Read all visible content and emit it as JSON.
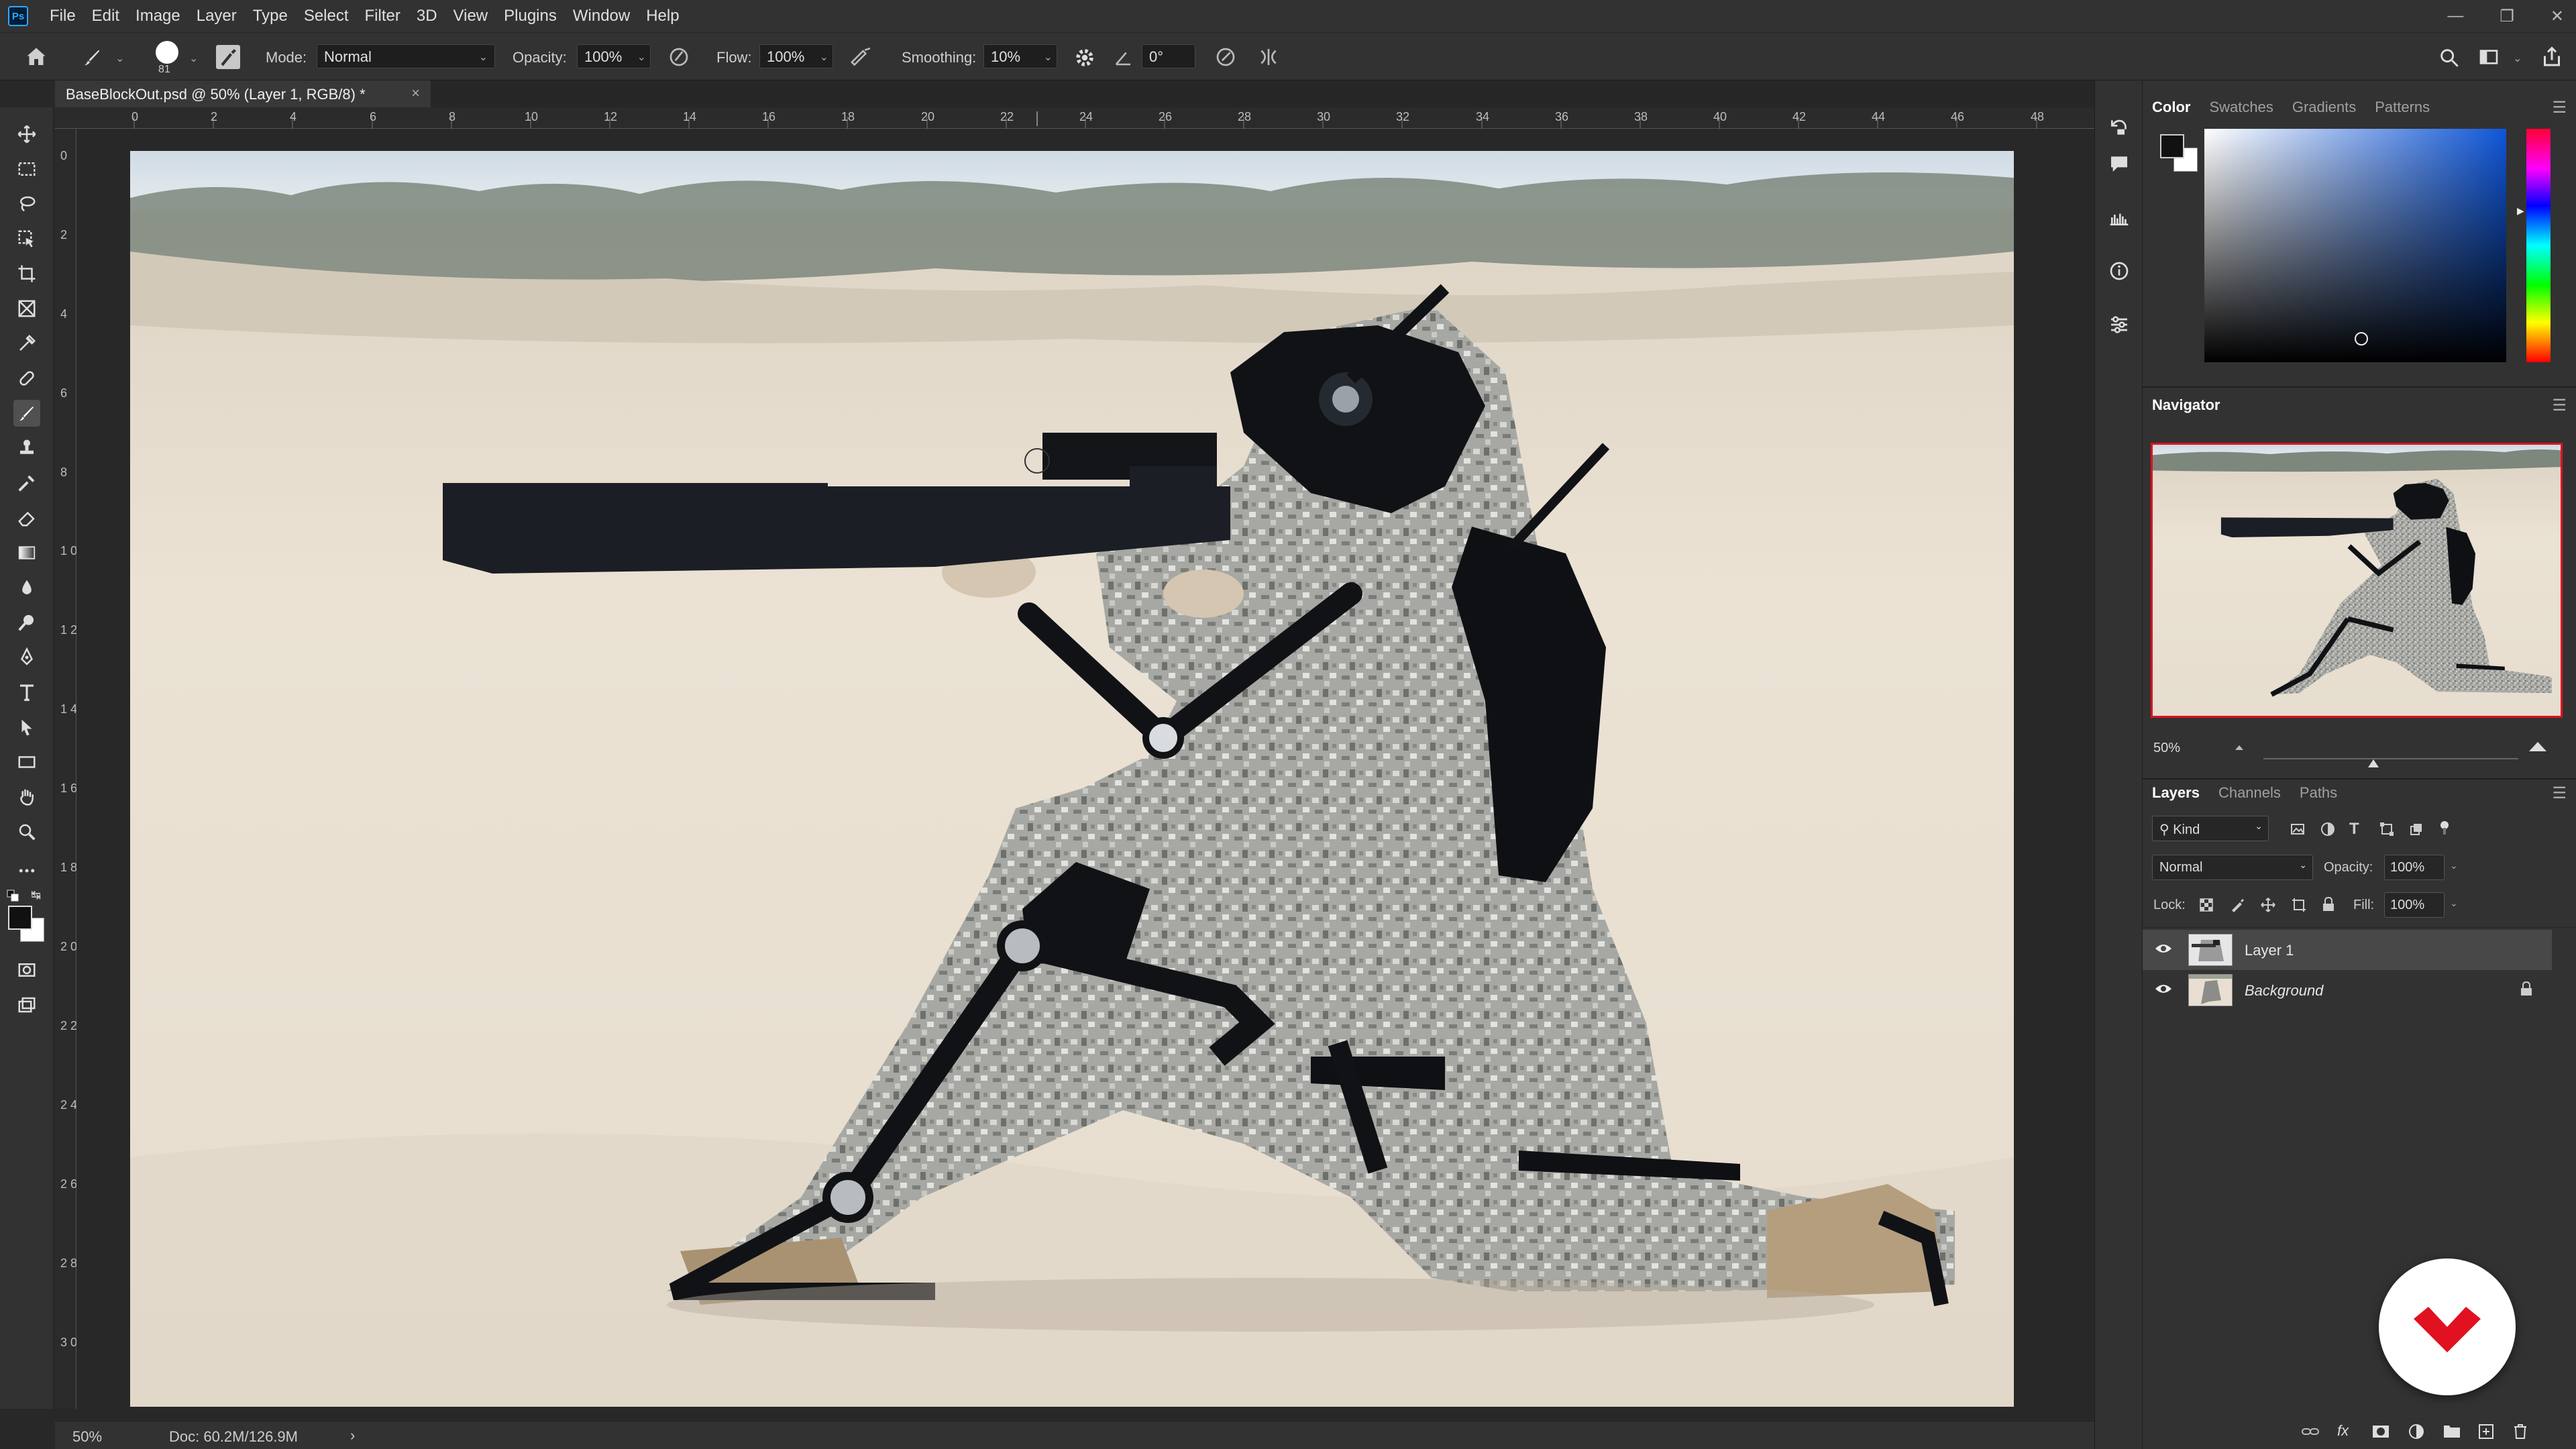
{
  "app": {
    "logo": "Ps"
  },
  "menu": [
    "File",
    "Edit",
    "Image",
    "Layer",
    "Type",
    "Select",
    "Filter",
    "3D",
    "View",
    "Plugins",
    "Window",
    "Help"
  ],
  "options": {
    "brush_size": "81",
    "mode_label": "Mode:",
    "mode_value": "Normal",
    "opacity_label": "Opacity:",
    "opacity_value": "100%",
    "flow_label": "Flow:",
    "flow_value": "100%",
    "smoothing_label": "Smoothing:",
    "smoothing_value": "10%",
    "angle_value": "0°"
  },
  "document": {
    "tab_title": "BaseBlockOut.psd @ 50% (Layer 1, RGB/8) *"
  },
  "ruler_top": [
    "0",
    "2",
    "4",
    "6",
    "8",
    "10",
    "12",
    "14",
    "16",
    "18",
    "20",
    "22",
    "24",
    "26",
    "28",
    "30",
    "32",
    "34",
    "36",
    "38",
    "40",
    "42",
    "44",
    "46",
    "48"
  ],
  "ruler_left": [
    "0",
    "2",
    "4",
    "6",
    "8",
    "1 0",
    "1 2",
    "1 4",
    "1 6",
    "1 8",
    "2 0",
    "2 2",
    "2 4",
    "2 6",
    "2 8",
    "3 0"
  ],
  "status": {
    "zoom": "50%",
    "doc": "Doc: 60.2M/126.9M"
  },
  "color_panel": {
    "tabs": [
      "Color",
      "Swatches",
      "Gradients",
      "Patterns"
    ],
    "active": "Color",
    "foreground": "#111111",
    "background": "#ffffff"
  },
  "navigator": {
    "title": "Navigator",
    "zoom": "50%"
  },
  "layers_panel": {
    "tabs": [
      "Layers",
      "Channels",
      "Paths"
    ],
    "active": "Layers",
    "filter_label": "Kind",
    "blend_mode": "Normal",
    "opacity_label": "Opacity:",
    "opacity_value": "100%",
    "lock_label": "Lock:",
    "fill_label": "Fill:",
    "fill_value": "100%",
    "layers": [
      {
        "name": "Layer 1",
        "selected": true,
        "visible": true
      },
      {
        "name": "Background",
        "selected": false,
        "visible": true,
        "locked": true
      }
    ]
  },
  "colors": {
    "accent_red": "#e1111f",
    "panel_bg": "#323232",
    "canvas_bg": "#282828"
  }
}
